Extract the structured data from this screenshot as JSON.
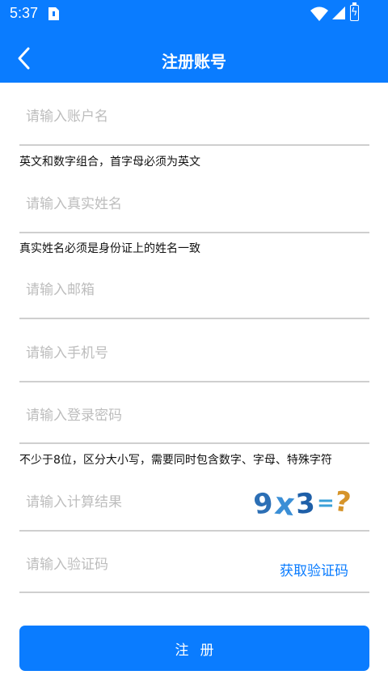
{
  "status_bar": {
    "time": "5:37"
  },
  "header": {
    "title": "注册账号"
  },
  "form": {
    "username": {
      "placeholder": "请输入账户名",
      "hint": "英文和数字组合，首字母必须为英文"
    },
    "realname": {
      "placeholder": "请输入真实姓名",
      "hint": "真实姓名必须是身份证上的姓名一致"
    },
    "email": {
      "placeholder": "请输入邮箱"
    },
    "phone": {
      "placeholder": "请输入手机号"
    },
    "password": {
      "placeholder": "请输入登录密码",
      "hint": "不少于8位，区分大小写，需要同时包含数字、字母、特殊字符"
    },
    "captcha": {
      "placeholder": "请输入计算结果",
      "image_chars": [
        "9",
        "x",
        "3",
        "=",
        "?"
      ],
      "image_colors": [
        "#2c6fb5",
        "#3b8fd6",
        "#1e5fa8",
        "#3aa0d8",
        "#d6942a"
      ]
    },
    "sms_code": {
      "placeholder": "请输入验证码",
      "button_label": "获取验证码"
    },
    "submit_label": "注册"
  },
  "colors": {
    "primary": "#0a7cff",
    "divider": "#cfcfcf",
    "placeholder": "#bdbdbd"
  }
}
